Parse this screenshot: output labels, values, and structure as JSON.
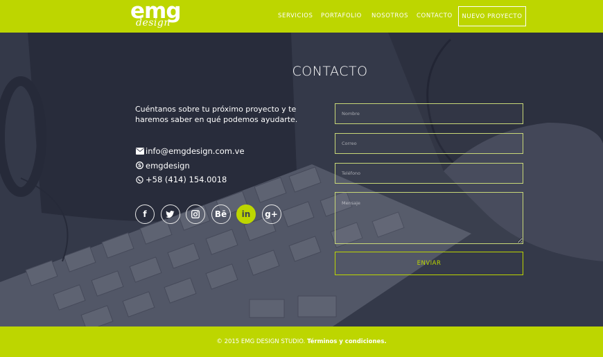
{
  "brand": {
    "logo_top": "emg",
    "logo_bottom": "design"
  },
  "nav": {
    "items": [
      {
        "label": "SERVICIOS"
      },
      {
        "label": "PORTAFOLIO"
      },
      {
        "label": "NOSOTROS"
      },
      {
        "label": "CONTACTO"
      }
    ],
    "cta": "NUEVO PROYECTO"
  },
  "contact": {
    "title": "CONTACTO",
    "intro": "Cuéntanos sobre tu próximo proyecto y te haremos saber en qué podemos ayudarte.",
    "email": "info@emgdesign.com.ve",
    "skype": "emgdesign",
    "phone": "+58 (414) 154.0018"
  },
  "socials": [
    {
      "icon": "facebook-icon",
      "glyph": "f"
    },
    {
      "icon": "twitter-icon",
      "glyph": ""
    },
    {
      "icon": "instagram-icon",
      "glyph": ""
    },
    {
      "icon": "behance-icon",
      "glyph": "Bē"
    },
    {
      "icon": "linkedin-icon",
      "glyph": "in"
    },
    {
      "icon": "google-plus-icon",
      "glyph": "g+"
    }
  ],
  "form": {
    "name_placeholder": "Nombre",
    "email_placeholder": "Correo",
    "phone_placeholder": "Teléfono",
    "message_placeholder": "Mensaje",
    "submit_label": "ENVIAR"
  },
  "footer": {
    "copyright": "© 2015 EMG DESIGN STUDIO. ",
    "terms_link": "Términos y condiciones."
  },
  "colors": {
    "accent": "#bdd600",
    "dark": "#3d4150"
  }
}
